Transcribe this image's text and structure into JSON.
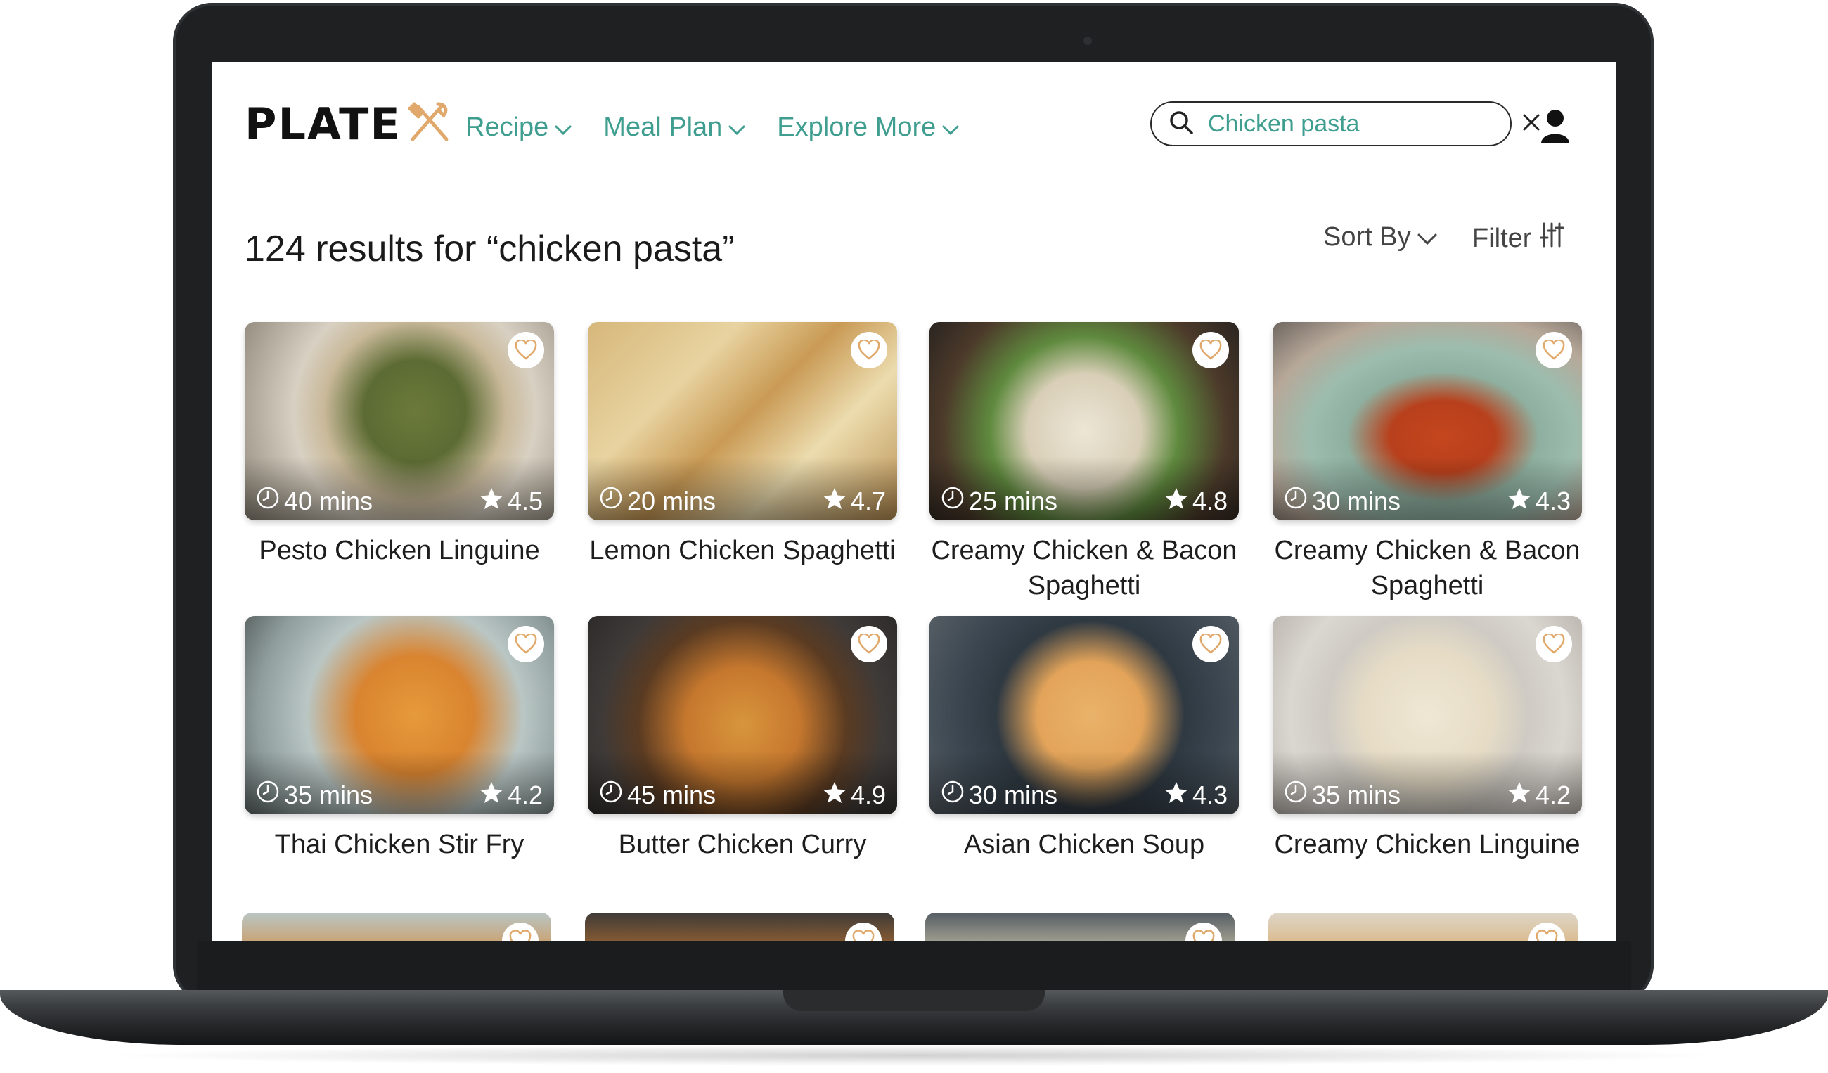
{
  "header": {
    "logo_text": "PLATE",
    "nav": [
      {
        "label": "Recipe"
      },
      {
        "label": "Meal Plan"
      },
      {
        "label": "Explore More"
      }
    ],
    "search": {
      "value": "Chicken pasta"
    }
  },
  "results": {
    "summary": "124 results for “chicken pasta”",
    "sort_label": "Sort By",
    "filter_label": "Filter"
  },
  "recipes": [
    {
      "title": "Pesto Chicken Linguine",
      "time": "40 mins",
      "rating": "4.5"
    },
    {
      "title": "Lemon Chicken Spaghetti",
      "time": "20 mins",
      "rating": "4.7"
    },
    {
      "title": "Creamy Chicken & Bacon Spaghetti",
      "time": "25 mins",
      "rating": "4.8"
    },
    {
      "title": "Creamy Chicken & Bacon Spaghetti",
      "time": "30 mins",
      "rating": "4.3"
    },
    {
      "title": "Thai Chicken Stir Fry",
      "time": "35 mins",
      "rating": "4.2"
    },
    {
      "title": "Butter Chicken Curry",
      "time": "45 mins",
      "rating": "4.9"
    },
    {
      "title": "Asian Chicken Soup",
      "time": "30 mins",
      "rating": "4.3"
    },
    {
      "title": "Creamy Chicken Linguine",
      "time": "35 mins",
      "rating": "4.2"
    }
  ],
  "theme": {
    "accent": "#3f9e8f",
    "logo_mark": "#e0a86a"
  }
}
